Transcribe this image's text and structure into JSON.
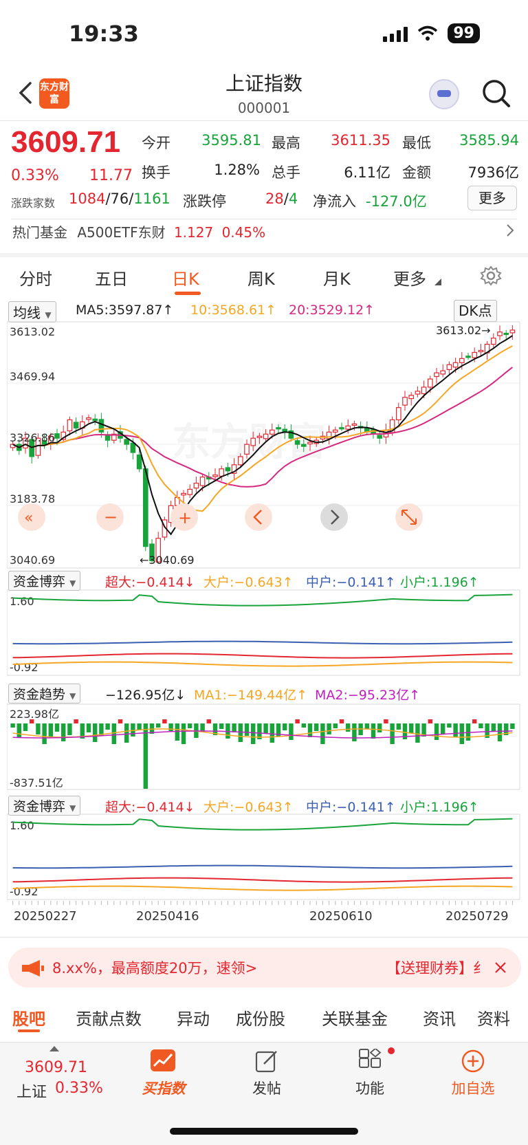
{
  "status": {
    "time": "19:33",
    "battery": "99"
  },
  "header": {
    "logo": "东方财富",
    "title": "上证指数",
    "code": "000001"
  },
  "quote": {
    "price": "3609.71",
    "change_pct": "0.33%",
    "change": "11.77",
    "open_label": "今开",
    "open": "3595.81",
    "high_label": "最高",
    "high": "3611.35",
    "low_label": "最低",
    "low": "3585.94",
    "turnover_label": "换手",
    "turnover": "1.28%",
    "volume_label": "总手",
    "volume": "6.11亿",
    "amount_label": "金额",
    "amount": "7936亿",
    "updown_label": "涨跌家数",
    "up": "1084",
    "flat": "76",
    "down": "1161",
    "limit_label": "涨跌停",
    "limit_up": "28",
    "limit_down": "4",
    "netflow_label": "净流入",
    "netflow": "-127.0亿",
    "more": "更多"
  },
  "hot_fund": {
    "label": "热门基金",
    "name": "A500ETF东财",
    "price": "1.127",
    "pct": "0.45%"
  },
  "ktabs": [
    "分时",
    "五日",
    "日K",
    "周K",
    "月K",
    "更多"
  ],
  "ktab_active": "日K",
  "ma": {
    "selector": "均线",
    "ma5": "MA5:3597.87↑",
    "ma10": "10:3568.61↑",
    "ma20": "20:3529.12↑",
    "dk": "DK点"
  },
  "kline": {
    "y_labels": [
      "3613.02",
      "3469.94",
      "3326.86",
      "3183.78",
      "3040.69"
    ],
    "high_mark": "3613.02→",
    "low_mark": "←3040.69"
  },
  "flow1": {
    "selector": "资金博弈",
    "super": "超大:−0.414↓",
    "large": "大户:−0.643↑",
    "mid": "中户:−0.141↑",
    "small": "小户:1.196↑",
    "ytop": "1.60",
    "ybot": "-0.92"
  },
  "flow2": {
    "selector": "资金趋势",
    "value": "−126.95亿↓",
    "ma1": "MA1:−149.44亿↑",
    "ma2": "MA2:−95.23亿↑",
    "ytop": "223.98亿",
    "ybot": "-837.51亿"
  },
  "flow3": {
    "selector": "资金博弈",
    "super": "超大:−0.414↓",
    "large": "大户:−0.643↑",
    "mid": "中户:−0.141↑",
    "small": "小户:1.196↑",
    "ytop": "1.60",
    "ybot": "-0.92"
  },
  "x_dates": [
    "20250227",
    "20250416",
    "20250610",
    "20250729"
  ],
  "banner": {
    "left": "8.xx%，最高额度20万，速领>",
    "right": "【送理财券】纟"
  },
  "section_tabs": [
    "股吧",
    "贡献点数",
    "异动",
    "成份股",
    "关联基金",
    "资讯",
    "资料"
  ],
  "bottom": {
    "price": "3609.71",
    "name": "上证",
    "pct": "0.33%",
    "buy": "买指数",
    "post": "发帖",
    "func": "功能",
    "add": "加自选"
  },
  "chart_data": {
    "type": "candlestick",
    "ylim": [
      3040.69,
      3613.02
    ],
    "close_trend": [
      3330,
      3315,
      3345,
      3300,
      3345,
      3330,
      3350,
      3345,
      3360,
      3390,
      3370,
      3385,
      3395,
      3388,
      3360,
      3340,
      3355,
      3345,
      3330,
      3310,
      3270,
      3080,
      3045,
      3100,
      3145,
      3180,
      3200,
      3210,
      3220,
      3235,
      3250,
      3245,
      3255,
      3270,
      3265,
      3280,
      3300,
      3330,
      3345,
      3350,
      3355,
      3365,
      3370,
      3360,
      3345,
      3330,
      3325,
      3335,
      3340,
      3350,
      3360,
      3365,
      3370,
      3375,
      3380,
      3370,
      3360,
      3355,
      3345,
      3365,
      3390,
      3420,
      3445,
      3450,
      3460,
      3470,
      3490,
      3505,
      3510,
      3525,
      3530,
      3540,
      3545,
      3555,
      3560,
      3575,
      3590,
      3605,
      3600,
      3609.71
    ],
    "series": [
      {
        "name": "MA5",
        "value": 3597.87
      },
      {
        "name": "10",
        "value": 3568.61
      },
      {
        "name": "20",
        "value": 3529.12
      }
    ]
  },
  "colors": {
    "accent": "#f05a22",
    "up": "#e3262f",
    "down": "#19a33b",
    "ma5": "#111111",
    "ma10": "#f5a623",
    "ma20": "#d6287f",
    "mid": "#3a5fb0"
  }
}
